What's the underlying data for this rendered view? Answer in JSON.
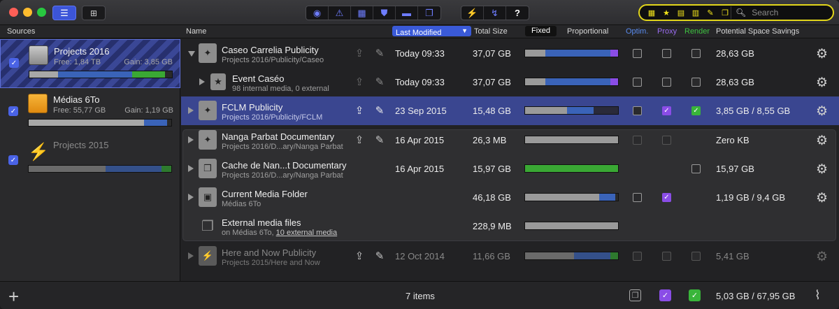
{
  "toolbar": {
    "search_placeholder": "Search",
    "view_tools": [
      "library",
      "warning",
      "grid",
      "shield",
      "folder",
      "copy"
    ],
    "action_tools": [
      "plug",
      "unplug",
      "help"
    ],
    "help_label": "?",
    "filters": [
      "grid-filter-icon",
      "star-filter-icon",
      "clapper-filter-icon",
      "film-filter-icon",
      "pencil-filter-icon",
      "copy-filter-icon"
    ]
  },
  "columns": {
    "sources": "Sources",
    "name": "Name",
    "last_modified": "Last Modified",
    "total_size": "Total Size",
    "fixed": "Fixed",
    "proportional": "Proportional",
    "optim": "Optim.",
    "proxy": "Proxy",
    "render": "Render",
    "savings": "Potential Space Savings"
  },
  "colors": {
    "optim": "#5a8cf0",
    "proxy": "#9a6cf0",
    "render": "#3ec240",
    "accent": "#3a5ad8"
  },
  "sources": [
    {
      "name": "Projects 2016",
      "free": "Free: 1,84 TB",
      "gain": "Gain: 3,85 GB",
      "checked": true,
      "selected": true
    },
    {
      "name": "Médias 6To",
      "free": "Free: 55,77 GB",
      "gain": "Gain: 1,19 GB",
      "checked": true,
      "selected": false
    },
    {
      "name": "Projects 2015",
      "free": "",
      "gain": "",
      "checked": true,
      "selected": false,
      "offline": true
    }
  ],
  "rows": [
    {
      "name": "Caseo Carrelia Publicity",
      "sub": "Projects 2016/Publicity/Caseo",
      "date": "Today 09:33",
      "size": "37,07 GB",
      "savings": "28,63 GB"
    },
    {
      "name": "Event Caséo",
      "sub": "98 internal media, 0 external",
      "date": "Today 09:33",
      "size": "37,07 GB",
      "savings": "28,63 GB"
    },
    {
      "name": "FCLM Publicity",
      "sub": "Projects 2016/Publicity/FCLM",
      "date": "23 Sep 2015",
      "size": "15,48 GB",
      "savings": "3,85 GB / 8,55 GB"
    },
    {
      "name": "Nanga Parbat Documentary",
      "sub": "Projects 2016/D...ary/Nanga Parbat",
      "date": "16 Apr 2015",
      "size": "26,3 MB",
      "savings": "Zero KB"
    },
    {
      "name": "Cache de Nan...t Documentary",
      "sub": "Projects 2016/D...ary/Nanga Parbat",
      "date": "16 Apr 2015",
      "size": "15,97 GB",
      "savings": "15,97 GB"
    },
    {
      "name": "Current Media Folder",
      "sub": "Médias 6To",
      "date": "",
      "size": "46,18 GB",
      "savings": "1,19 GB / 9,4 GB"
    },
    {
      "name": "External media files",
      "sub_prefix": "on Médias 6To,",
      "sub_link": "10 external media",
      "date": "",
      "size": "228,9 MB",
      "savings": ""
    },
    {
      "name": "Here and Now Publicity",
      "sub": "Projects 2015/Here and Now",
      "date": "12 Oct 2014",
      "size": "11,66 GB",
      "savings": "5,41 GB"
    }
  ],
  "footer": {
    "items": "7 items",
    "total": "5,03 GB / 67,95 GB"
  }
}
